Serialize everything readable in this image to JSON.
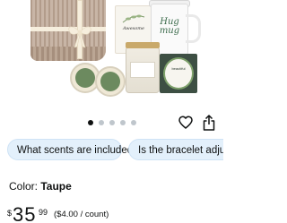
{
  "product_image": {
    "card_text": "Awesome",
    "mug_text": "Hug mug",
    "plaque_text": "beautiful"
  },
  "gallery": {
    "dot_count": 5,
    "active_index": 0
  },
  "actions": {
    "wishlist_icon": "heart-icon",
    "share_icon": "share-icon"
  },
  "suggestions": [
    {
      "label": "What scents are included?"
    },
    {
      "label": "Is the bracelet adjustable?"
    }
  ],
  "variant": {
    "label": "Color:",
    "value": "Taupe"
  },
  "price": {
    "symbol": "$",
    "whole": "35",
    "fraction": "99",
    "unit_price": "($4.00 / count)"
  },
  "colors": {
    "chip_bg": "#e3f0fb",
    "active_dot": "#0f1111",
    "inactive_dot": "#bfc6cc"
  }
}
